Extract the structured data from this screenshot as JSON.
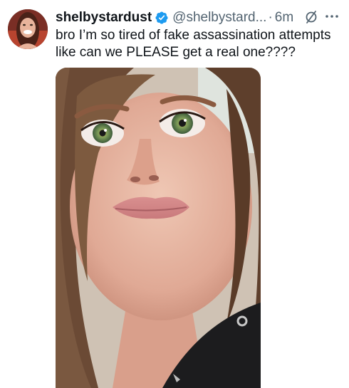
{
  "tweet": {
    "display_name": "shelbystardust",
    "handle": "@shelbystard...",
    "separator": "·",
    "timestamp": "6m",
    "text_lines": [
      "bro I’m so tired of fake assassination attempts",
      "like can we PLEASE get a real one????"
    ],
    "icons": {
      "verified": "verified-badge-icon",
      "grok": "grok-icon",
      "more": "more-options-icon"
    }
  },
  "colors": {
    "text_primary": "#0f1419",
    "text_secondary": "#536471",
    "verified_blue": "#1d9bf0",
    "background": "#ffffff"
  }
}
